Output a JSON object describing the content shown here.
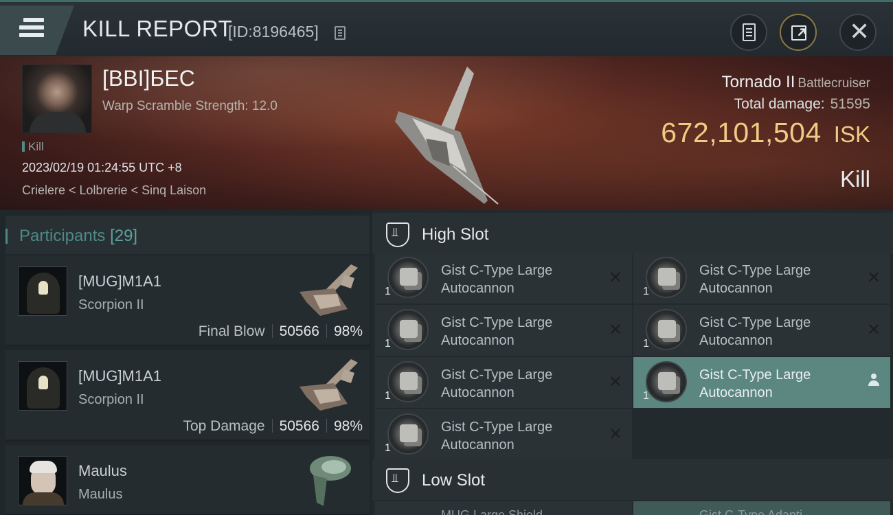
{
  "header": {
    "title": "KILL REPORT",
    "report_id": "[ID:8196465]",
    "icons": [
      "menu-icon",
      "copy-icon",
      "clipboard-icon",
      "share-icon",
      "close-icon"
    ]
  },
  "victim": {
    "name": "[BBI]БЕС",
    "warp_scramble": "Warp Scramble Strength: 12.0",
    "result_tag": "Kill",
    "datetime": "2023/02/19 01:24:55 UTC +8",
    "location": "Crielere < Lolbrerie < Sinq Laison",
    "ship_name": "Tornado II",
    "ship_class": "Battlecruiser",
    "total_damage_label": "Total damage:",
    "total_damage": "51595",
    "isk_value": "672,101,504",
    "isk_unit": "ISK",
    "result": "Kill"
  },
  "participants": {
    "label": "Participants",
    "count": "[29]",
    "rows": [
      {
        "name": "[MUG]M1A1",
        "ship": "Scorpion II",
        "role": "Final Blow",
        "damage": "50566",
        "percent": "98%"
      },
      {
        "name": "[MUG]M1A1",
        "ship": "Scorpion II",
        "role": "Top Damage",
        "damage": "50566",
        "percent": "98%"
      },
      {
        "name": "Maulus",
        "ship": "Maulus",
        "role": "",
        "damage": "",
        "percent": ""
      }
    ]
  },
  "fitting": {
    "high_slot_label": "High Slot",
    "low_slot_label": "Low Slot",
    "high_modules": [
      {
        "qty": "1",
        "name": "Gist C-Type Large Autocannon",
        "state": "destroyed"
      },
      {
        "qty": "1",
        "name": "Gist C-Type Large Autocannon",
        "state": "destroyed"
      },
      {
        "qty": "1",
        "name": "Gist C-Type Large Autocannon",
        "state": "destroyed"
      },
      {
        "qty": "1",
        "name": "Gist C-Type Large Autocannon",
        "state": "destroyed"
      },
      {
        "qty": "1",
        "name": "Gist C-Type Large Autocannon",
        "state": "destroyed"
      },
      {
        "qty": "1",
        "name": "Gist C-Type Large Autocannon",
        "state": "dropped"
      },
      {
        "qty": "1",
        "name": "Gist C-Type Large Autocannon",
        "state": "destroyed"
      }
    ],
    "low_modules_peek": [
      "MUG Large Shield...",
      "Gist C-Type Adapti..."
    ]
  },
  "colors": {
    "accent_teal": "#4e8a85",
    "isk_gold": "#f0cb84",
    "selected_row": "#5c8780"
  }
}
